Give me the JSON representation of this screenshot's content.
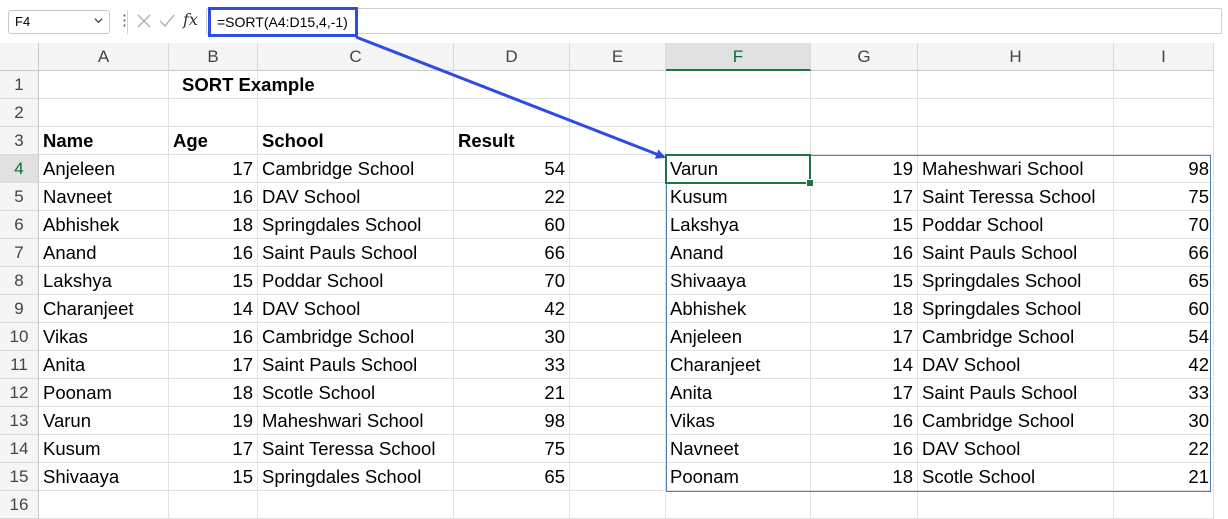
{
  "formula_bar": {
    "name_box": "F4",
    "formula": "=SORT(A4:D15,4,-1)",
    "fx_label": "fx"
  },
  "column_headers": [
    "A",
    "B",
    "C",
    "D",
    "E",
    "F",
    "G",
    "H",
    "I"
  ],
  "row_headers": [
    "1",
    "2",
    "3",
    "4",
    "5",
    "6",
    "7",
    "8",
    "9",
    "10",
    "11",
    "12",
    "13",
    "14",
    "15",
    "16"
  ],
  "title": "SORT Example",
  "table_headers": [
    "Name",
    "Age",
    "School",
    "Result"
  ],
  "source_rows": [
    [
      "Anjeleen",
      "17",
      "Cambridge School",
      "54"
    ],
    [
      "Navneet",
      "16",
      "DAV School",
      "22"
    ],
    [
      "Abhishek",
      "18",
      "Springdales School",
      "60"
    ],
    [
      "Anand",
      "16",
      "Saint Pauls School",
      "66"
    ],
    [
      "Lakshya",
      "15",
      "Poddar School",
      "70"
    ],
    [
      "Charanjeet",
      "14",
      "DAV School",
      "42"
    ],
    [
      "Vikas",
      "16",
      "Cambridge School",
      "30"
    ],
    [
      "Anita",
      "17",
      "Saint Pauls School",
      "33"
    ],
    [
      "Poonam",
      "18",
      "Scotle School",
      "21"
    ],
    [
      "Varun",
      "19",
      "Maheshwari School",
      "98"
    ],
    [
      "Kusum",
      "17",
      "Saint Teressa School",
      "75"
    ],
    [
      "Shivaaya",
      "15",
      "Springdales School",
      "65"
    ]
  ],
  "sorted_rows": [
    [
      "Varun",
      "19",
      "Maheshwari School",
      "98"
    ],
    [
      "Kusum",
      "17",
      "Saint Teressa School",
      "75"
    ],
    [
      "Lakshya",
      "15",
      "Poddar School",
      "70"
    ],
    [
      "Anand",
      "16",
      "Saint Pauls School",
      "66"
    ],
    [
      "Shivaaya",
      "15",
      "Springdales School",
      "65"
    ],
    [
      "Abhishek",
      "18",
      "Springdales School",
      "60"
    ],
    [
      "Anjeleen",
      "17",
      "Cambridge School",
      "54"
    ],
    [
      "Charanjeet",
      "14",
      "DAV School",
      "42"
    ],
    [
      "Anita",
      "17",
      "Saint Pauls School",
      "33"
    ],
    [
      "Vikas",
      "16",
      "Cambridge School",
      "30"
    ],
    [
      "Navneet",
      "16",
      "DAV School",
      "22"
    ],
    [
      "Poonam",
      "18",
      "Scotle School",
      "21"
    ]
  ],
  "colors": {
    "highlight_box": "#2f4be6",
    "selection_green": "#217346",
    "spill_border": "#4a7fb5"
  }
}
